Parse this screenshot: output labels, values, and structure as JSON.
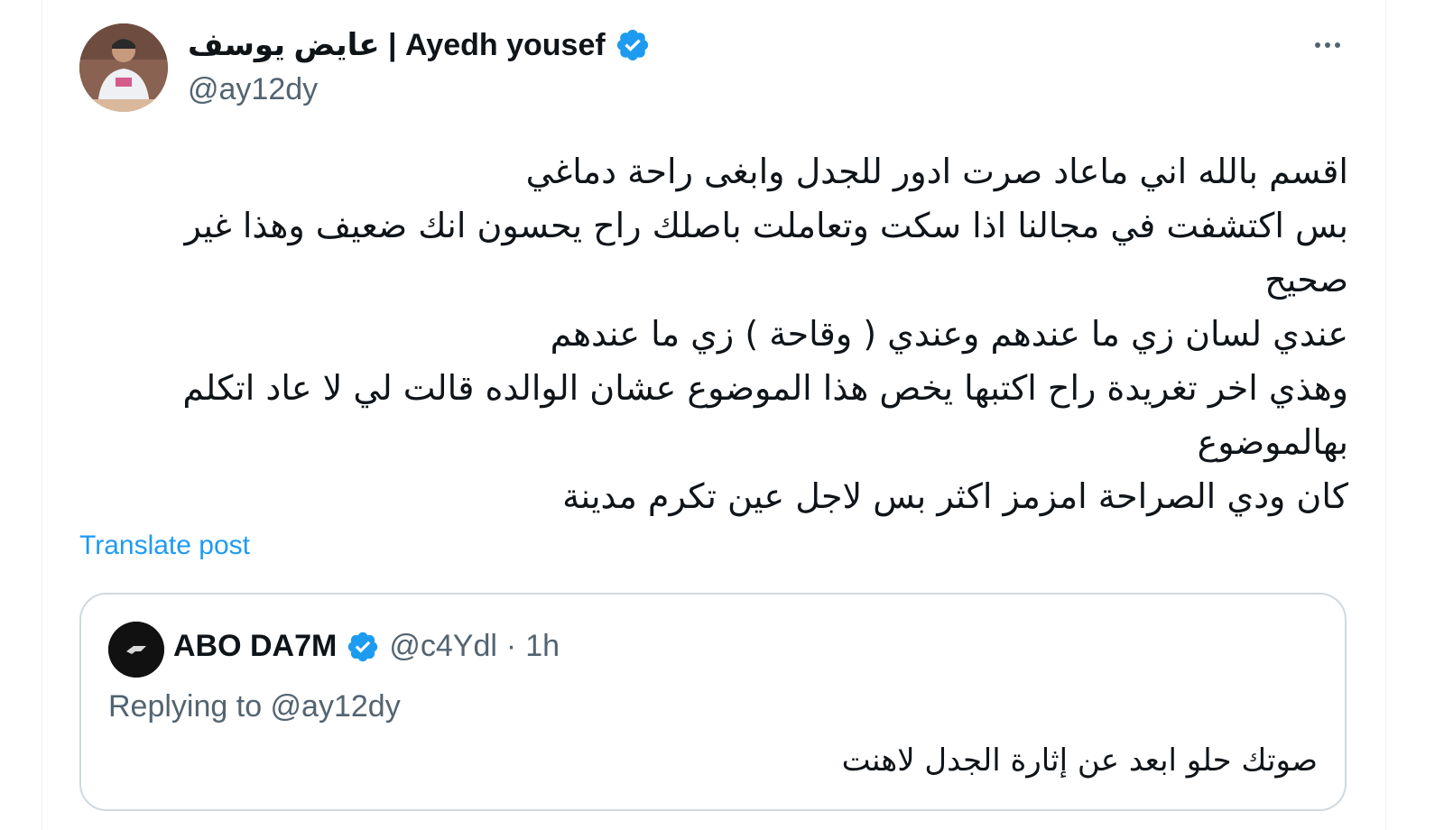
{
  "post": {
    "author": {
      "display_name": "عايض يوسف | Ayedh yousef",
      "handle": "@ay12dy",
      "verified": true
    },
    "more_icon": "more-horizontal-icon",
    "text_lines": [
      "اقسم بالله اني ماعاد صرت ادور للجدل وابغى راحة دماغي",
      "بس اكتشفت في مجالنا اذا سكت وتعاملت باصلك راح يحسون انك ضعيف وهذا غير",
      "صحيح",
      "عندي لسان زي ما عندهم وعندي ( وقاحة ) زي ما عندهم",
      "وهذي اخر تغريدة راح اكتبها يخص هذا الموضوع عشان الوالده قالت لي لا عاد اتكلم",
      "بهالموضوع",
      "كان ودي الصراحة امزمز اكثر بس لاجل عين تكرم مدينة"
    ],
    "translate_label": "Translate post"
  },
  "quote": {
    "author": {
      "display_name": "ABO DA7M",
      "handle": "@c4Ydl",
      "verified": true
    },
    "separator": "·",
    "time": "1h",
    "replying_to": "Replying to @ay12dy",
    "text": "صوتك حلو ابعد عن إثارة الجدل لاهنت"
  },
  "colors": {
    "verified_blue": "#1d9bf0",
    "link_blue": "#1d9bf0",
    "secondary_text": "#536471",
    "border": "#cfd9de"
  }
}
